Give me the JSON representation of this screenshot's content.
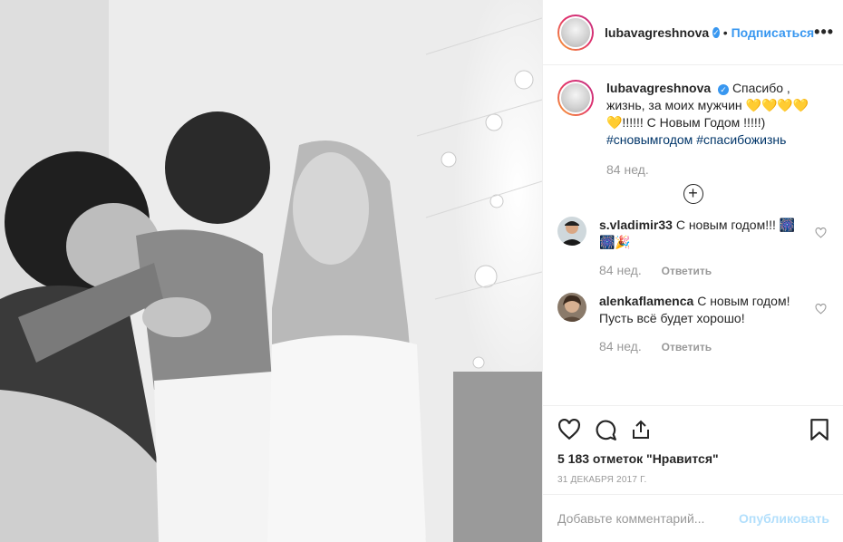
{
  "post": {
    "photo_icon": "family-photo",
    "author": {
      "username": "lubavagreshnova",
      "verified_icon": "verified-badge-icon",
      "follow_label": "Подписаться",
      "separator": "•",
      "more_label": "•••"
    },
    "caption": {
      "username": "lubavagreshnova",
      "text": "Спасибо , жизнь, за моих мужчин 💛💛💛💛💛!!!!!! С Новым Годом !!!!!)",
      "hashtags": [
        "#сновымгодом",
        "#спасибожизнь"
      ],
      "age": "84 нед."
    },
    "load_more_label": "+",
    "comments": [
      {
        "username": "s.vladimir33",
        "text": "С новым годом!!! 🎆🎆🎉",
        "age": "84 нед.",
        "reply_label": "Ответить"
      },
      {
        "username": "alenkaflamenca",
        "text": "С новым годом! Пусть всё будет хорошо!",
        "age": "84 нед.",
        "reply_label": "Ответить"
      }
    ],
    "likes": "5 183 отметок \"Нравится\"",
    "date": "31 ДЕКАБРЯ 2017 Г.",
    "add_comment": {
      "placeholder": "Добавьте комментарий...",
      "publish_label": "Опубликовать"
    }
  },
  "colors": {
    "accent": "#3897f0",
    "hashtag": "#003569",
    "muted": "#999999",
    "publish_disabled": "#b2dffc"
  }
}
